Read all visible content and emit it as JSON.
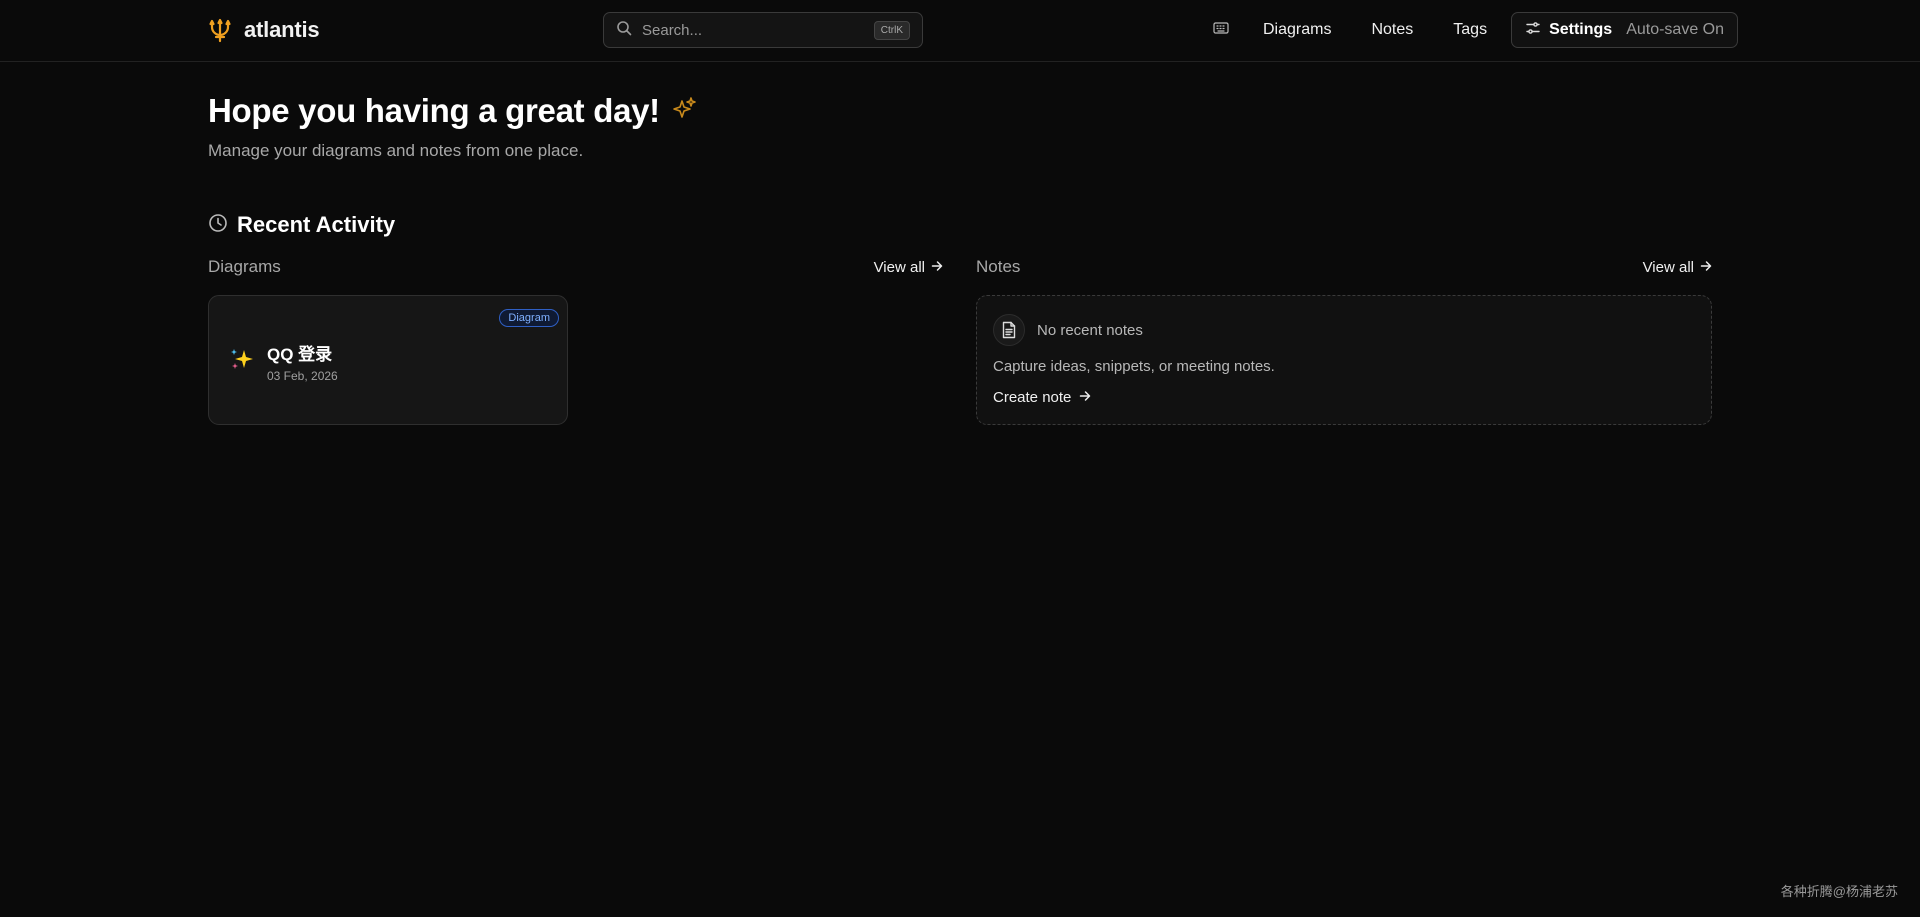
{
  "header": {
    "logo_text": "atlantis",
    "search_placeholder": "Search...",
    "search_shortcut": "CtrlK",
    "nav": [
      "Diagrams",
      "Notes",
      "Tags"
    ],
    "settings_label": "Settings",
    "autosave_label": "Auto-save On"
  },
  "greeting": {
    "title": "Hope you having a great day!",
    "subtitle": "Manage your diagrams and notes from one place."
  },
  "recent": {
    "title": "Recent Activity",
    "diagrams": {
      "heading": "Diagrams",
      "view_all": "View all",
      "items": [
        {
          "badge": "Diagram",
          "title": "QQ 登录",
          "date": "03 Feb, 2026"
        }
      ]
    },
    "notes": {
      "heading": "Notes",
      "view_all": "View all",
      "empty_title": "No recent notes",
      "empty_desc": "Capture ideas, snippets, or meeting notes.",
      "create_label": "Create note"
    }
  },
  "watermark": "各种折腾@杨浦老苏",
  "colors": {
    "background": "#0a0a0a",
    "accent": "#f0a020",
    "badge_blue": "#7fb0ff"
  },
  "icons": [
    "trident-icon",
    "search-icon",
    "keyboard-icon",
    "sliders-icon",
    "sparkles-icon",
    "clock-icon",
    "arrow-right-icon",
    "sparkle-emoji-icon",
    "document-icon"
  ]
}
